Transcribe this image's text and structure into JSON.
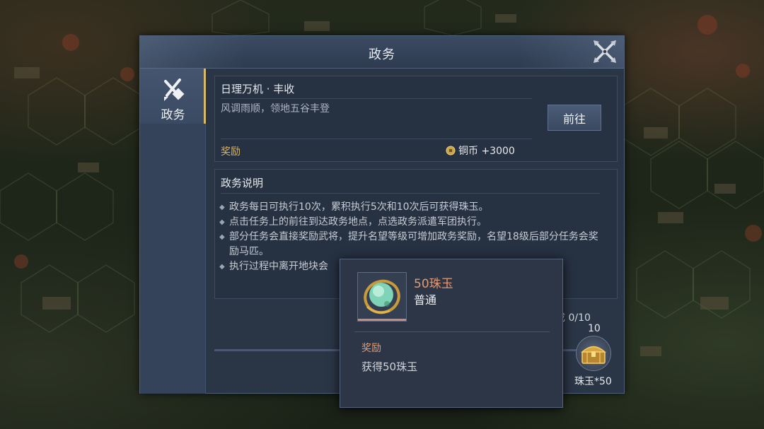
{
  "window": {
    "title": "政务",
    "close_icon": "close-crossed-swords-icon"
  },
  "sidebar": {
    "tabs": [
      {
        "label": "政务",
        "icon": "brush-pen-icon",
        "active": true
      }
    ]
  },
  "task": {
    "title": "日理万机 · 丰收",
    "description": "风调雨顺，领地五谷丰登",
    "reward_label": "奖励",
    "reward_icon": "copper-coin-icon",
    "reward_value": "铜币 +3000",
    "go_button": "前往"
  },
  "info": {
    "title": "政务说明",
    "items": [
      "政务每日可执行10次，累积执行5次和10次后可获得珠玉。",
      "点击任务上的前往到达政务地点，点选政务派遣军团执行。",
      "部分任务会直接奖励武将，提升名望等级可增加政务奖励，名望18级后部分任务会奖励马匹。",
      "执行过程中离开地块会"
    ]
  },
  "progress": {
    "complete_text": "已完成 0/10",
    "chest_count": "10",
    "chest_reward": "珠玉*50",
    "chest_icon": "treasure-chest-icon",
    "fraction": 0
  },
  "tooltip": {
    "item_name": "50珠玉",
    "rarity": "普通",
    "item_icon": "jade-orb-icon",
    "reward_label": "奖励",
    "reward_desc": "获得50珠玉"
  },
  "colors": {
    "accent_gold": "#d6b56a",
    "item_orange": "#e39a72",
    "panel_bg": "#2a3546"
  }
}
